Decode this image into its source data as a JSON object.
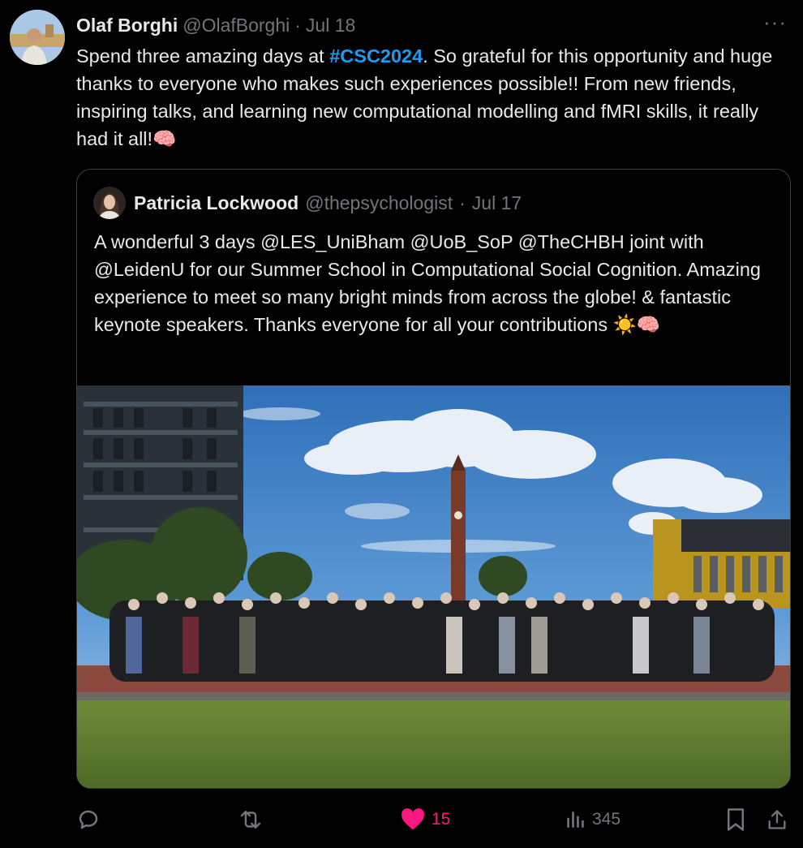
{
  "tweet": {
    "author_name": "Olaf Borghi",
    "author_handle": "@OlafBorghi",
    "separator": "·",
    "date": "Jul 18",
    "more": "···",
    "text_before": "Spend three amazing days at ",
    "hashtag": "#CSC2024",
    "text_after": ". So grateful for this opportunity and huge thanks to everyone who makes such experiences possible!! From new friends, inspiring talks, and learning new computational modelling and fMRI skills, it really had it all!",
    "emoji": "🧠"
  },
  "quote": {
    "author_name": "Patricia Lockwood",
    "author_handle": "@thepsychologist",
    "separator": "·",
    "date": "Jul 17",
    "text": "A wonderful 3 days @LES_UniBham @UoB_SoP @TheCHBH joint with @LeidenU for our Summer School in Computational Social Cognition. Amazing experience to meet so many bright minds from across the globe! & fantastic keynote speakers. Thanks everyone for all your contributions",
    "emoji": "☀️🧠"
  },
  "actions": {
    "reply_icon": "reply-icon",
    "retweet_icon": "retweet-icon",
    "like_icon": "heart-icon",
    "like_count": "15",
    "views_icon": "views-icon",
    "views_count": "345",
    "bookmark_icon": "bookmark-icon",
    "share_icon": "share-icon"
  },
  "colors": {
    "background": "#000000",
    "text": "#e7e9ea",
    "muted": "#71767b",
    "hashtag": "#1d9bf0",
    "like": "#f91880",
    "border": "#3a3f44"
  }
}
